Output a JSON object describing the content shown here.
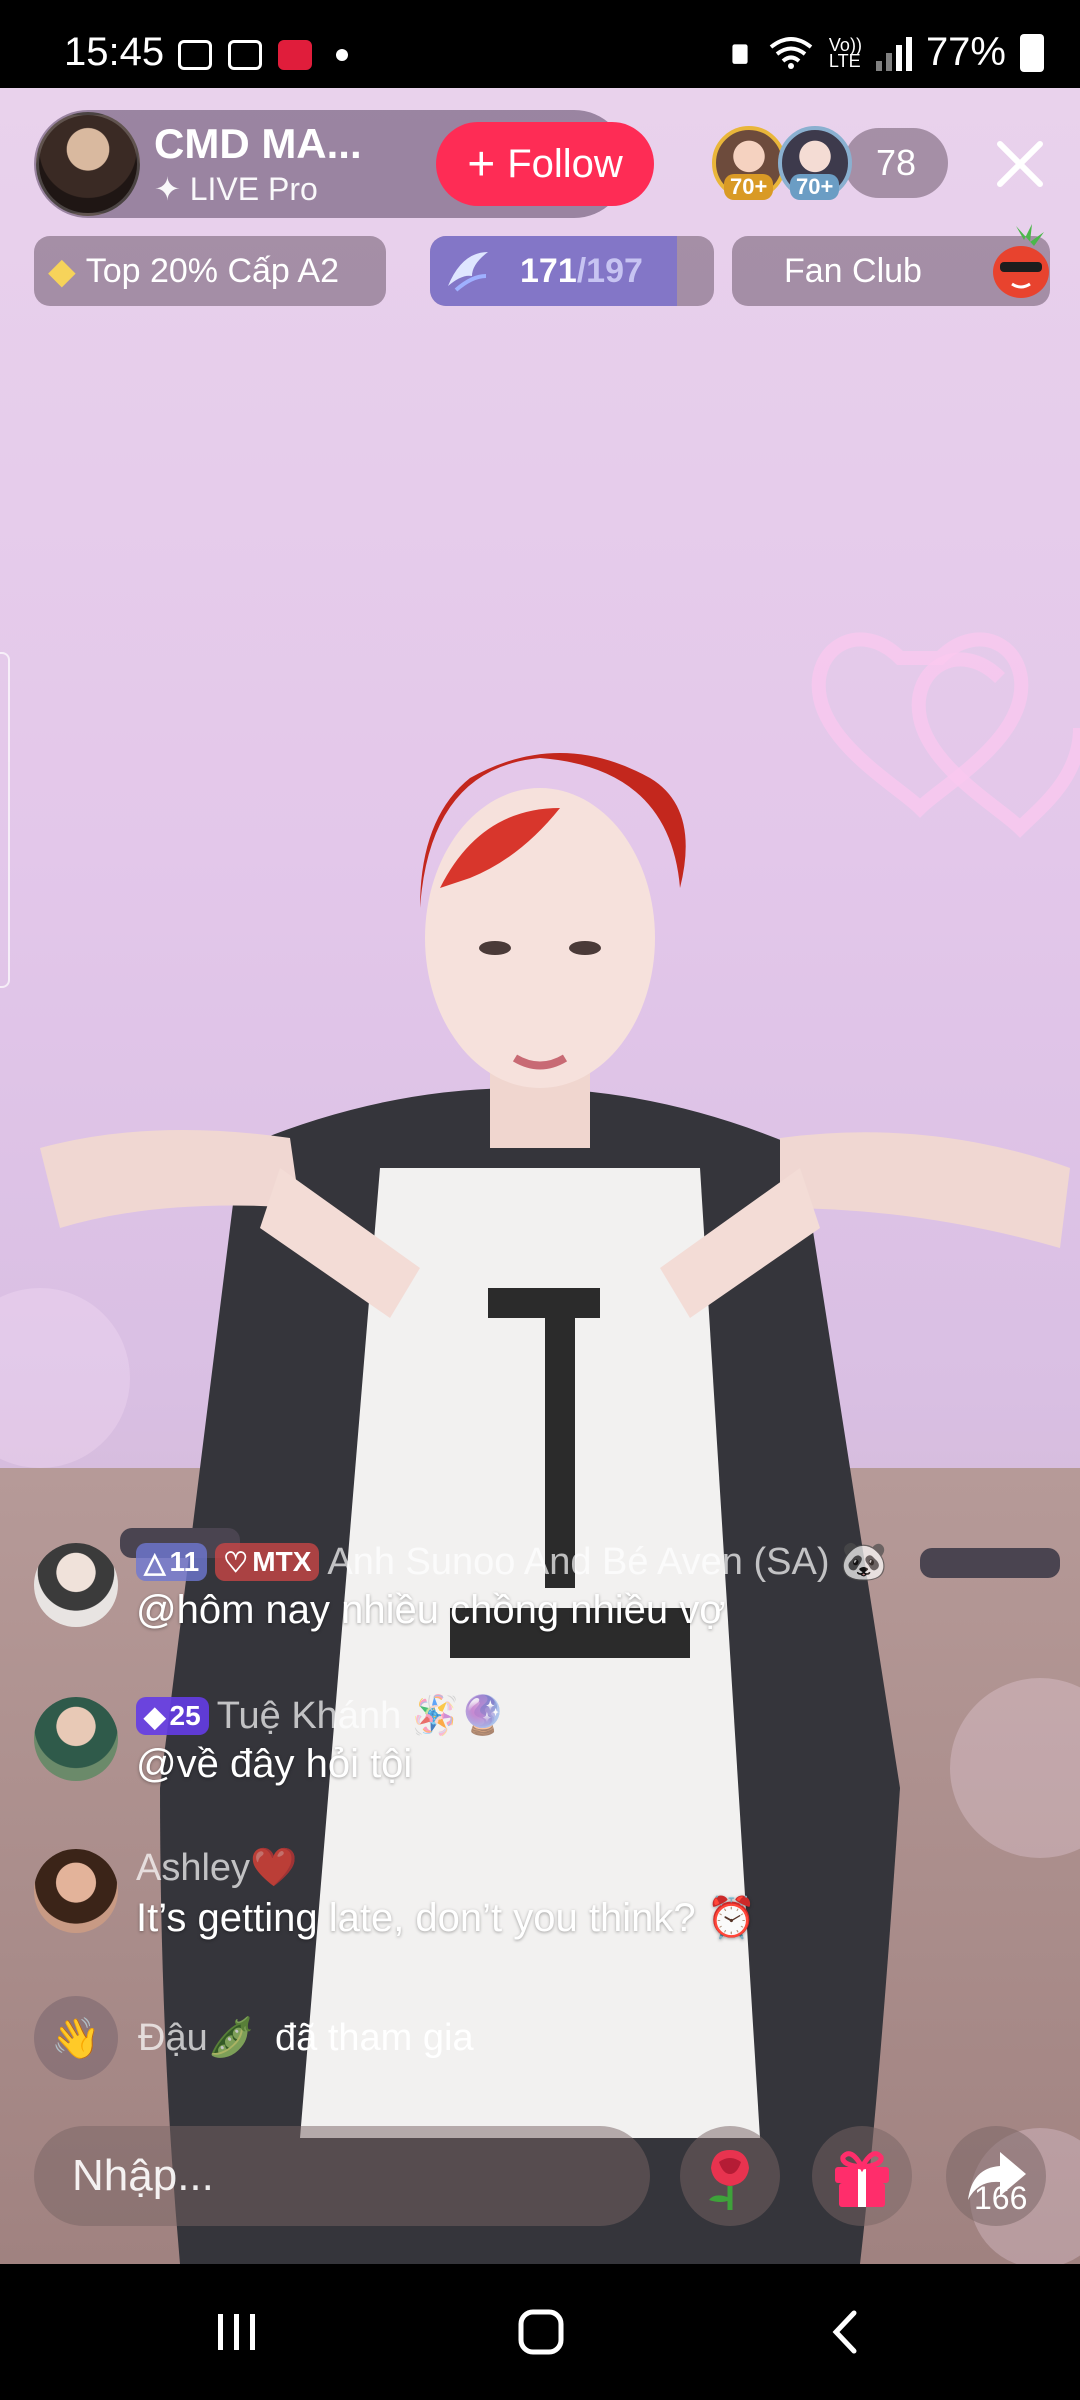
{
  "status_bar": {
    "time": "15:45",
    "network_top": "Vo))",
    "network_bottom": "LTE",
    "battery": "77%"
  },
  "host": {
    "name": "CMD MA...",
    "subtitle": "LIVE Pro",
    "follow_label": "Follow"
  },
  "viewers": {
    "avatar_levels": [
      "70+",
      "70+"
    ],
    "count": "78"
  },
  "chips": {
    "top_rank": "Top 20% Cấp A2",
    "progress_value": "171",
    "progress_max": "/197",
    "progress_fraction": 0.868,
    "fan_club": "Fan Club"
  },
  "comments": [
    {
      "badges": [
        "11",
        "MTX"
      ],
      "username": "Anh Sunoo And Bé Aven (SA) 🐼",
      "text": "@hôm nay nhiều chồng nhiều vợ"
    },
    {
      "badges": [
        "25"
      ],
      "username": "Tuệ Khánh 🪅🔮",
      "text": "@về đây hỏi tội"
    },
    {
      "badges": [],
      "username": "Ashley❤️",
      "text": "It’s getting late, don’t you think? ⏰"
    }
  ],
  "join_event": {
    "username": "Đậu🫛",
    "text": "đã tham gia"
  },
  "bottom_bar": {
    "input_placeholder": "Nhập...",
    "share_count": "166"
  },
  "colors": {
    "follow": "#fe2c55",
    "gift": "#ff2d6b",
    "badge_purple": "#6a3cf0"
  }
}
